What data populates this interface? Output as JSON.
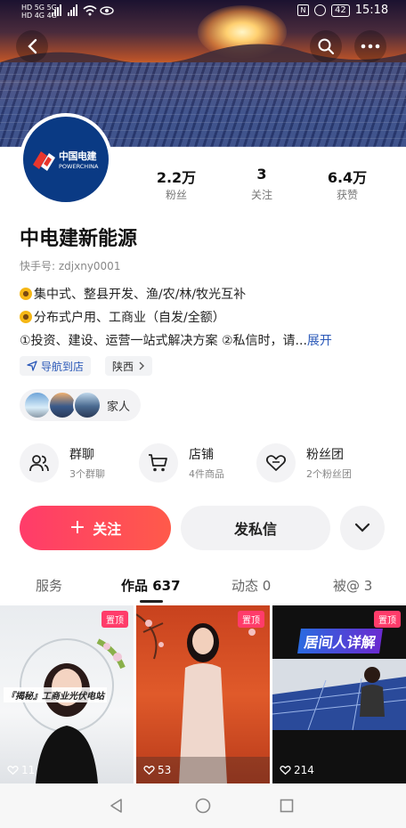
{
  "status_bar": {
    "left": [
      "HD 5G",
      "HD 4G",
      "5G",
      "4G"
    ],
    "battery": "42",
    "time": "15:18"
  },
  "profile": {
    "logo_cn": "中国电建",
    "logo_en": "POWERCHINA",
    "name": "中电建新能源",
    "kuaishou_id": "快手号: zdjxny0001",
    "stats": [
      {
        "value": "2.2万",
        "label": "粉丝"
      },
      {
        "value": "3",
        "label": "关注"
      },
      {
        "value": "6.4万",
        "label": "获赞"
      }
    ],
    "bio": [
      "集中式、整县开发、渔/农/林/牧光互补",
      "分布式户用、工商业（自发/全额）",
      "①投资、建设、运营一站式解决方案 ②私信时，请..."
    ],
    "expand_label": "展开",
    "chips": {
      "nav_label": "导航到店",
      "region_label": "陕西"
    },
    "fans_label": "家人"
  },
  "services": [
    {
      "title": "群聊",
      "sub": "3个群聊",
      "icon": "group-chat-icon"
    },
    {
      "title": "店铺",
      "sub": "4件商品",
      "icon": "cart-icon"
    },
    {
      "title": "粉丝团",
      "sub": "2个粉丝团",
      "icon": "heart-outline-icon"
    }
  ],
  "actions": {
    "follow": "关注",
    "message": "发私信"
  },
  "tabs": [
    {
      "label": "服务"
    },
    {
      "label": "作品 637"
    },
    {
      "label": "动态 0"
    },
    {
      "label": "被@ 3"
    }
  ],
  "videos": [
    {
      "pinned": "置顶",
      "caption": "『揭秘』工商业光伏电站",
      "likes": "11"
    },
    {
      "pinned": "置顶",
      "caption": "",
      "likes": "53"
    },
    {
      "pinned": "置顶",
      "caption": "居间人详解",
      "likes": "214"
    }
  ],
  "colors": {
    "accent": "#ff3c6a",
    "link": "#2a58b8",
    "brand_blue": "#0a3a84"
  }
}
